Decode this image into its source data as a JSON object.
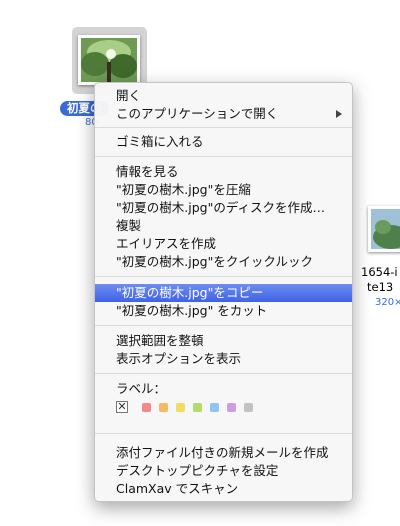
{
  "desktop": {
    "icon1": {
      "name": "初夏の",
      "size": "80"
    },
    "icon2": {
      "name_line1": "1654-i",
      "name_line2": "te13",
      "size": "320×"
    }
  },
  "menu": {
    "items": [
      {
        "label": "開く"
      },
      {
        "label": "このアプリケーションで開く",
        "submenu": true
      },
      {
        "label": "ゴミ箱に入れる"
      },
      {
        "label": "情報を見る"
      },
      {
        "label": "\"初夏の樹木.jpg\"を圧縮"
      },
      {
        "label": "\"初夏の樹木.jpg\"のディスクを作成…"
      },
      {
        "label": "複製"
      },
      {
        "label": "エイリアスを作成"
      },
      {
        "label": "\"初夏の樹木.jpg\"をクイックルック"
      },
      {
        "label": "\"初夏の樹木.jpg\"をコピー",
        "highlighted": true
      },
      {
        "label": "\"初夏の樹木.jpg\" をカット"
      },
      {
        "label": "選択範囲を整頓"
      },
      {
        "label": "表示オプションを表示"
      },
      {
        "label": "ラベル："
      },
      {
        "label": "添付ファイル付きの新規メールを作成"
      },
      {
        "label": "デスクトップピクチャを設定"
      },
      {
        "label": "ClamXav でスキャン"
      }
    ],
    "label_colors": [
      "#f28a87",
      "#f6b864",
      "#f3dc62",
      "#b5dc6a",
      "#8ec5f4",
      "#d19be3",
      "#c2c2c2"
    ],
    "label_none_glyph": "✕",
    "highlight_color": "#3e63e6"
  }
}
